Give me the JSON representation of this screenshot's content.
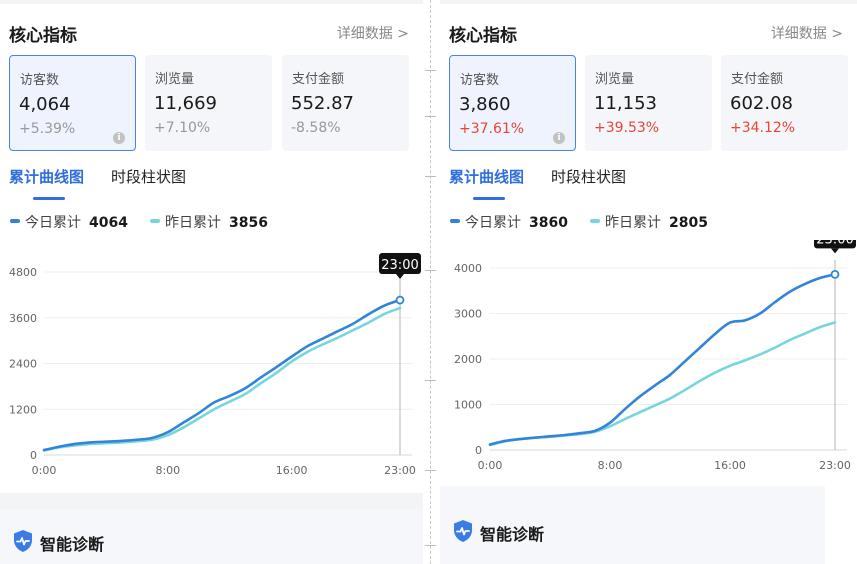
{
  "colors": {
    "today": "#3384d9",
    "yesterday": "#77d6dc",
    "tab_active": "#2f6fdd",
    "pct_up": "#e5463a",
    "pct_muted": "#999999"
  },
  "panels": [
    {
      "id": "left",
      "header": {
        "title": "核心指标",
        "more": "详细数据 >"
      },
      "metrics": [
        {
          "label": "访客数",
          "value": "4,064",
          "change": "+5.39%",
          "active": true,
          "change_color": "#999999",
          "info": true
        },
        {
          "label": "浏览量",
          "value": "11,669",
          "change": "+7.10%",
          "active": false,
          "change_color": "#999999"
        },
        {
          "label": "支付金额",
          "value": "552.87",
          "change": "-8.58%",
          "active": false,
          "change_color": "#999999"
        }
      ],
      "tabs": [
        "累计曲线图",
        "时段柱状图"
      ],
      "legend": [
        {
          "label": "今日累计",
          "value": "4064"
        },
        {
          "label": "昨日累计",
          "value": "3856"
        }
      ],
      "chart_data": {
        "type": "line",
        "x_ticks": [
          "0:00",
          "8:00",
          "16:00",
          "23:00"
        ],
        "y_ticks": [
          "0",
          "1200",
          "2400",
          "3600",
          "4800"
        ],
        "ylim": [
          0,
          4800
        ],
        "tooltip": "23:00",
        "series": [
          {
            "name": "今日累计",
            "x": [
              0,
              1,
              2,
              3,
              4,
              5,
              6,
              7,
              8,
              9,
              10,
              11,
              12,
              13,
              14,
              15,
              16,
              17,
              18,
              19,
              20,
              21,
              22,
              23
            ],
            "values": [
              130,
              220,
              290,
              330,
              350,
              370,
              400,
              450,
              600,
              850,
              1100,
              1380,
              1550,
              1750,
              2030,
              2300,
              2580,
              2850,
              3050,
              3250,
              3450,
              3700,
              3920,
              4064
            ]
          },
          {
            "name": "昨日累计",
            "x": [
              0,
              1,
              2,
              3,
              4,
              5,
              6,
              7,
              8,
              9,
              10,
              11,
              12,
              13,
              14,
              15,
              16,
              17,
              18,
              19,
              20,
              21,
              22,
              23
            ],
            "values": [
              120,
              200,
              250,
              290,
              310,
              330,
              360,
              400,
              520,
              720,
              960,
              1200,
              1400,
              1600,
              1880,
              2150,
              2450,
              2700,
              2900,
              3080,
              3280,
              3480,
              3700,
              3856
            ]
          }
        ]
      },
      "diagnosis": {
        "title": "智能诊断"
      }
    },
    {
      "id": "right",
      "header": {
        "title": "核心指标",
        "more": "详细数据 >"
      },
      "metrics": [
        {
          "label": "访客数",
          "value": "3,860",
          "change": "+37.61%",
          "active": true,
          "change_color": "#e5463a",
          "info": true
        },
        {
          "label": "浏览量",
          "value": "11,153",
          "change": "+39.53%",
          "active": false,
          "change_color": "#e5463a"
        },
        {
          "label": "支付金额",
          "value": "602.08",
          "change": "+34.12%",
          "active": false,
          "change_color": "#e5463a"
        }
      ],
      "tabs": [
        "累计曲线图",
        "时段柱状图"
      ],
      "legend": [
        {
          "label": "今日累计",
          "value": "3860"
        },
        {
          "label": "昨日累计",
          "value": "2805"
        }
      ],
      "chart_data": {
        "type": "line",
        "x_ticks": [
          "0:00",
          "8:00",
          "16:00",
          "23:00"
        ],
        "y_ticks": [
          "0",
          "1000",
          "2000",
          "3000",
          "4000"
        ],
        "ylim": [
          0,
          4000
        ],
        "tooltip": "23:00",
        "series": [
          {
            "name": "今日累计",
            "x": [
              0,
              1,
              2,
              3,
              4,
              5,
              6,
              7,
              8,
              9,
              10,
              11,
              12,
              13,
              14,
              15,
              16,
              17,
              18,
              19,
              20,
              21,
              22,
              23
            ],
            "values": [
              120,
              200,
              240,
              270,
              300,
              330,
              370,
              420,
              600,
              900,
              1180,
              1420,
              1650,
              1950,
              2250,
              2550,
              2800,
              2850,
              3000,
              3250,
              3480,
              3650,
              3780,
              3860
            ]
          },
          {
            "name": "昨日累计",
            "x": [
              0,
              1,
              2,
              3,
              4,
              5,
              6,
              7,
              8,
              9,
              10,
              11,
              12,
              13,
              14,
              15,
              16,
              17,
              18,
              19,
              20,
              21,
              22,
              23
            ],
            "values": [
              110,
              190,
              240,
              270,
              290,
              320,
              350,
              400,
              520,
              680,
              830,
              980,
              1130,
              1320,
              1520,
              1700,
              1850,
              1970,
              2100,
              2250,
              2420,
              2560,
              2700,
              2805
            ]
          }
        ]
      },
      "diagnosis": {
        "title": "智能诊断"
      }
    }
  ]
}
